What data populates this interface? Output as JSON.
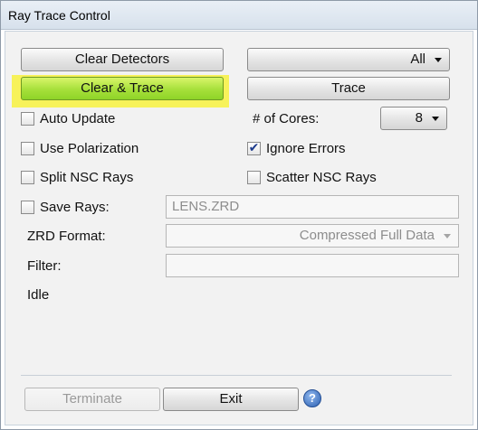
{
  "window": {
    "title": "Ray Trace Control"
  },
  "buttons": {
    "clear_detectors": "Clear Detectors",
    "all_dropdown": "All",
    "clear_trace": "Clear & Trace",
    "trace": "Trace",
    "terminate": "Terminate",
    "exit": "Exit"
  },
  "options": {
    "auto_update": {
      "label": "Auto Update",
      "checked": false
    },
    "use_polarization": {
      "label": "Use Polarization",
      "checked": false
    },
    "split_nsc_rays": {
      "label": "Split NSC Rays",
      "checked": false
    },
    "save_rays": {
      "label": "Save Rays:",
      "checked": false
    },
    "ignore_errors": {
      "label": "Ignore Errors",
      "checked": true,
      "check_glyph": "✔"
    },
    "scatter_nsc_rays": {
      "label": "Scatter NSC Rays",
      "checked": false
    }
  },
  "cores": {
    "label": "# of Cores:",
    "value": "8"
  },
  "save_rays_file": "LENS.ZRD",
  "zrd_format": {
    "label": "ZRD Format:",
    "value": "Compressed Full Data"
  },
  "filter": {
    "label": "Filter:",
    "value": ""
  },
  "status": "Idle",
  "help_icon": "?",
  "colors": {
    "highlight": "#f7f25a",
    "trace_button": "#a6e03a",
    "check_mark": "#1d3b8c",
    "help_icon": "#2c5fb0"
  }
}
